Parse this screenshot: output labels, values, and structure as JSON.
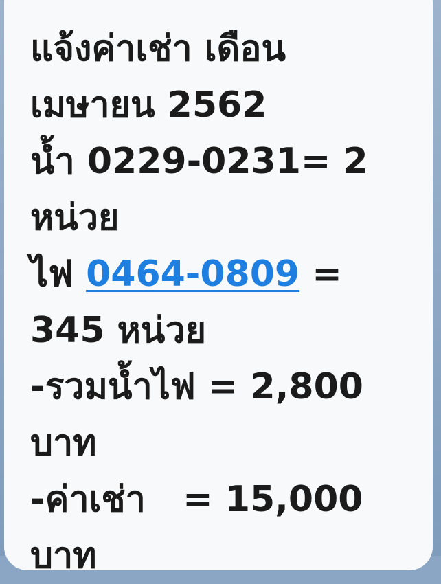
{
  "message": {
    "line1": "แจ้งค่าเช่า เดือน",
    "line2": "เมษายน 2562",
    "line3": "น้ำ 0229-0231= 2",
    "line4": "หน่วย",
    "line5_prefix": "ไฟ ",
    "line5_link": "0464-0809",
    "line5_suffix": " =",
    "line6": "345 หน่วย",
    "line7": "-รวมน้ำไฟ = 2,800",
    "line8": "บาท",
    "line9": "-ค่าเช่า   = 15,000",
    "line10": "บาท"
  },
  "colors": {
    "bubble": "#f7f9fb",
    "text": "#1b1b1b",
    "link": "#1f7fe0",
    "background": "#8aa6c4"
  }
}
